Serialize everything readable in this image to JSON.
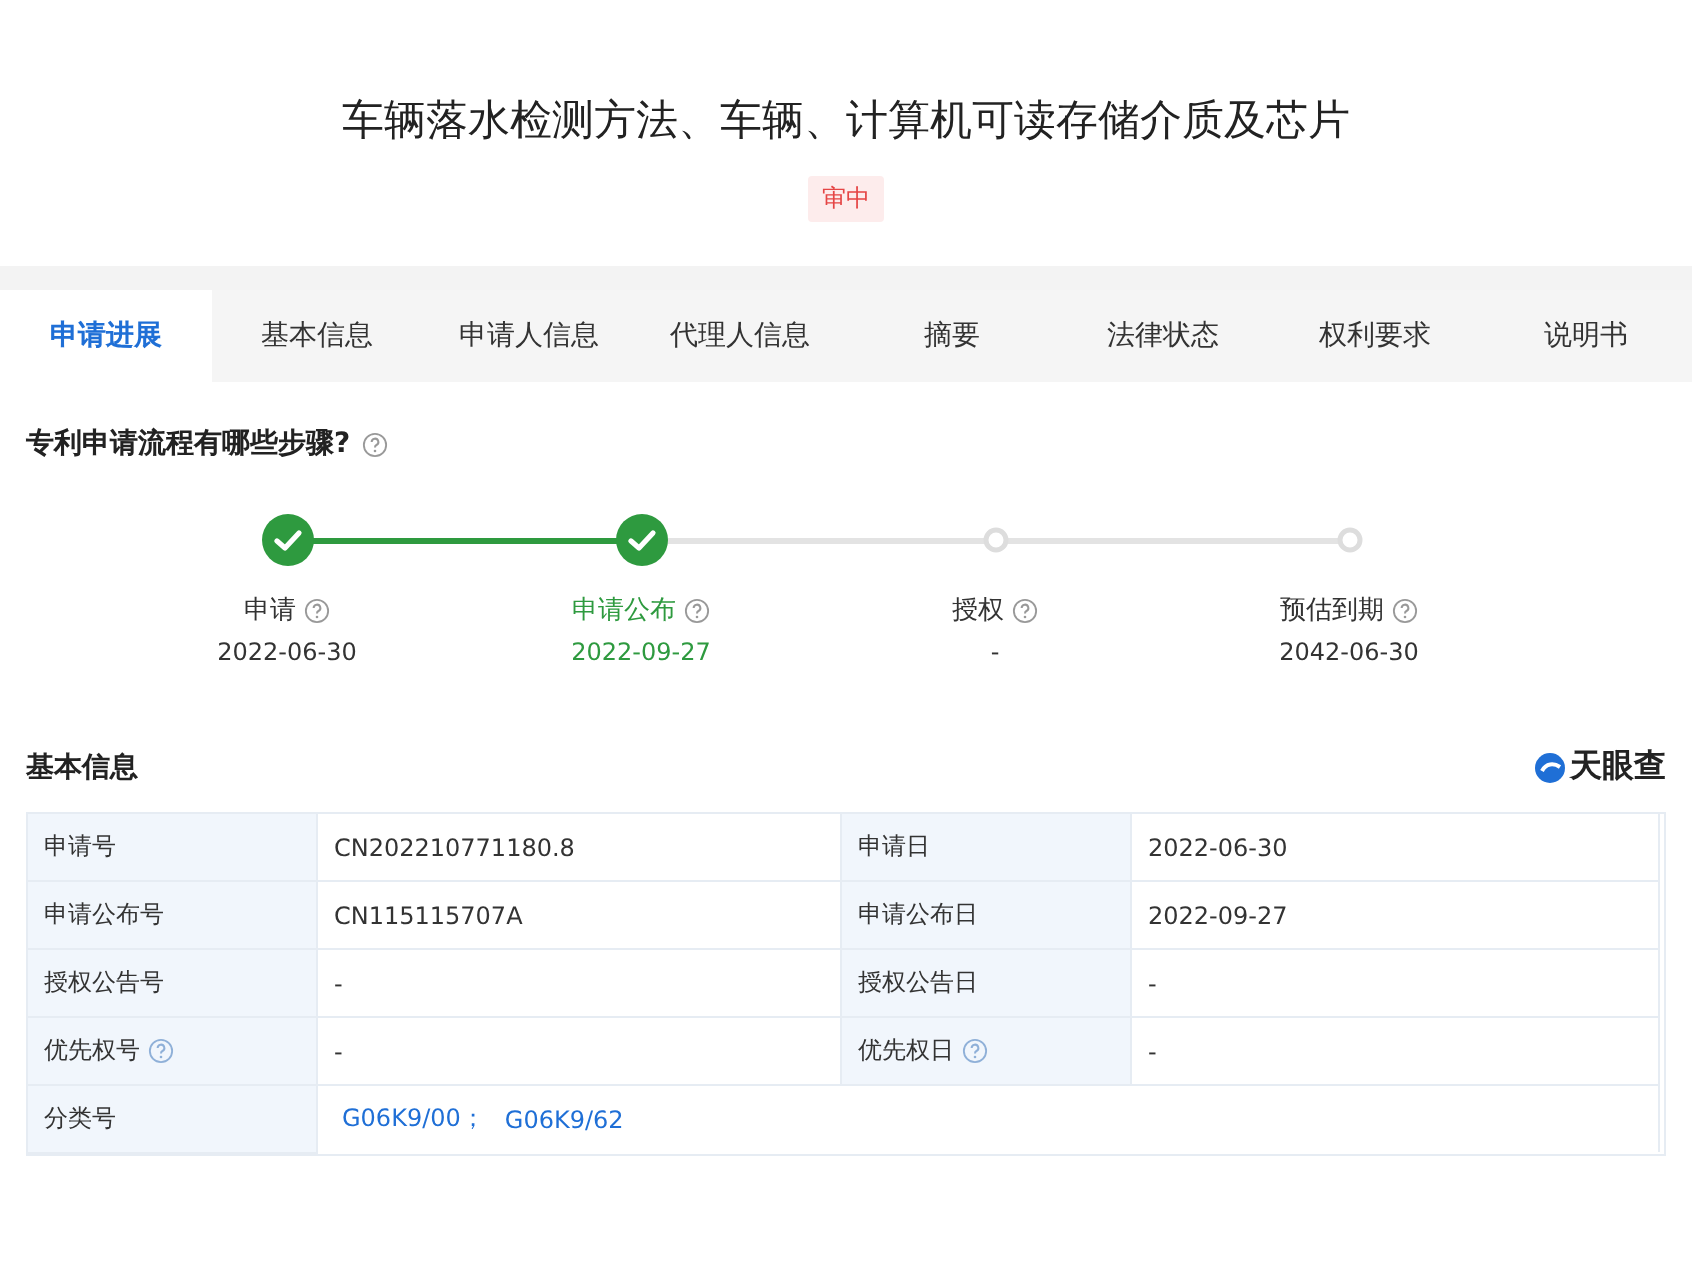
{
  "header": {
    "title": "车辆落水检测方法、车辆、计算机可读存储介质及芯片",
    "badge": "审中"
  },
  "tabs": [
    {
      "label": "申请进展",
      "selected": true
    },
    {
      "label": "基本信息",
      "selected": false
    },
    {
      "label": "申请人信息",
      "selected": false
    },
    {
      "label": "代理人信息",
      "selected": false
    },
    {
      "label": "摘要",
      "selected": false
    },
    {
      "label": "法律状态",
      "selected": false
    },
    {
      "label": "权利要求",
      "selected": false
    },
    {
      "label": "说明书",
      "selected": false
    }
  ],
  "progress": {
    "title": "专利申请流程有哪些步骤?",
    "steps": [
      {
        "label": "申请",
        "date": "2022-06-30",
        "done": true,
        "selected": false
      },
      {
        "label": "申请公布",
        "date": "2022-09-27",
        "done": true,
        "selected": true
      },
      {
        "label": "授权",
        "date": "-",
        "done": false,
        "selected": false
      },
      {
        "label": "预估到期",
        "date": "2042-06-30",
        "done": false,
        "selected": false
      }
    ]
  },
  "basic_info": {
    "title": "基本信息",
    "logo": "天眼查",
    "rows": [
      {
        "cells": [
          {
            "label": "申请号",
            "value": "CN202210771180.8",
            "help": false
          },
          {
            "label": "申请日",
            "value": "2022-06-30",
            "help": false
          }
        ]
      },
      {
        "cells": [
          {
            "label": "申请公布号",
            "value": "CN115115707A",
            "help": false
          },
          {
            "label": "申请公布日",
            "value": "2022-09-27",
            "help": false
          }
        ]
      },
      {
        "cells": [
          {
            "label": "授权公告号",
            "value": "-",
            "help": false
          },
          {
            "label": "授权公告日",
            "value": "-",
            "help": false
          }
        ]
      },
      {
        "cells": [
          {
            "label": "优先权号",
            "value": "-",
            "help": true
          },
          {
            "label": "优先权日",
            "value": "-",
            "help": true
          }
        ]
      }
    ],
    "class_row": {
      "label": "分类号",
      "links": [
        "G06K9/00；",
        "G06K9/62"
      ]
    }
  }
}
